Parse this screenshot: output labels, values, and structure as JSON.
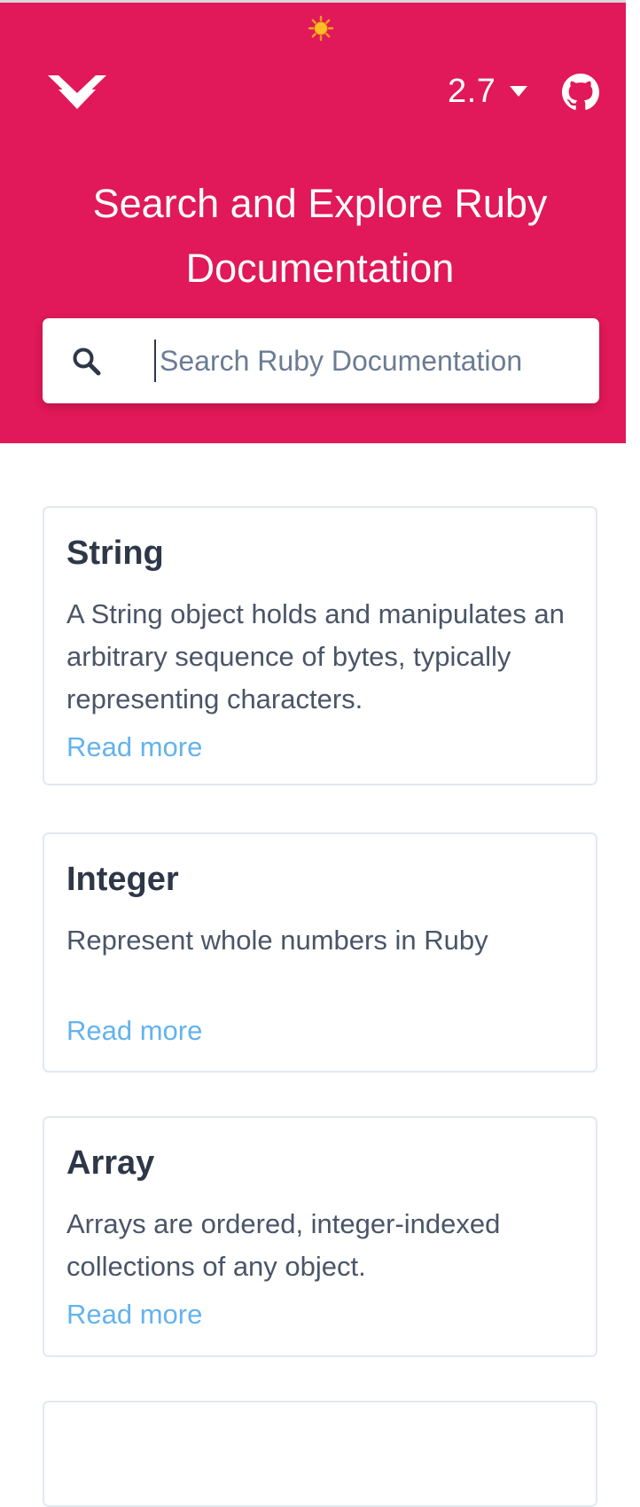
{
  "header": {
    "version": "2.7"
  },
  "hero": {
    "title_line1": "Search and Explore Ruby",
    "title_line2": "Documentation"
  },
  "search": {
    "placeholder": "Search Ruby Documentation",
    "value": ""
  },
  "cards": [
    {
      "title": "String",
      "description": "A String object holds and manipulates an arbitrary sequence of bytes, typically representing characters.",
      "link": "Read more"
    },
    {
      "title": "Integer",
      "description": "Represent whole numbers in Ruby",
      "link": "Read more"
    },
    {
      "title": "Array",
      "description": "Arrays are ordered, integer-indexed collections of any object.",
      "link": "Read more"
    }
  ],
  "icons": {
    "theme_toggle": "sun-icon",
    "logo": "chevron-logo-icon",
    "version_dropdown": "caret-down-icon",
    "github": "github-icon",
    "search": "search-icon"
  },
  "colors": {
    "brand": "#e11859",
    "link": "#63b3ed",
    "heading": "#2d3748",
    "body_text": "#4a5568",
    "card_border": "#e2e8f0"
  }
}
